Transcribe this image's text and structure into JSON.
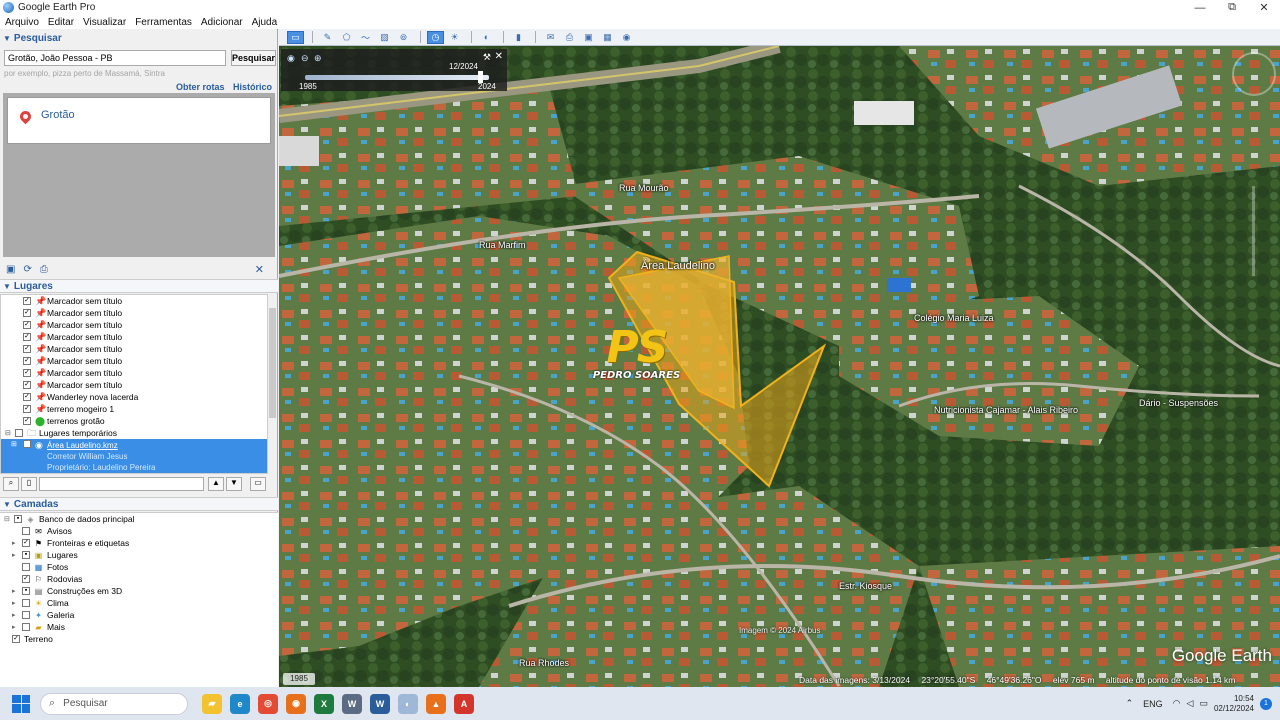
{
  "window": {
    "title": "Google Earth Pro",
    "minimize": "—",
    "maximize": "⧉",
    "close": "✕"
  },
  "menu": [
    "Arquivo",
    "Editar",
    "Visualizar",
    "Ferramentas",
    "Adicionar",
    "Ajuda"
  ],
  "search": {
    "header": "Pesquisar",
    "query": "Grotão, João Pessoa - PB",
    "button": "Pesquisar",
    "hint": "por exemplo, pizza perto de Massamá, Sintra",
    "routes": "Obter rotas",
    "history": "Histórico",
    "result": "Grotão"
  },
  "places": {
    "header": "Lugares",
    "items": [
      "Marcador sem título",
      "Marcador sem título",
      "Marcador sem título",
      "Marcador sem título",
      "Marcador sem título",
      "Marcador sem título",
      "Marcador sem título",
      "Marcador sem título",
      "Wanderley nova lacerda",
      "terreno mogeiro 1",
      "terrenos grotão"
    ],
    "temp_folder": "Lugares temporários",
    "selected": {
      "name": "Área Laudelino.kmz",
      "line1": "Corretor William Jesus",
      "line2": "Proprietário: Laudelino Pereira"
    }
  },
  "layers": {
    "header": "Camadas",
    "items": [
      {
        "label": "Banco de dados principal",
        "icon": "database-icon",
        "checked": true
      },
      {
        "label": "Avisos",
        "icon": "envelope-icon",
        "checked": false
      },
      {
        "label": "Fronteiras e etiquetas",
        "icon": "border-icon",
        "checked": true
      },
      {
        "label": "Lugares",
        "icon": "places-icon",
        "checked": true
      },
      {
        "label": "Fotos",
        "icon": "photo-icon",
        "checked": false
      },
      {
        "label": "Rodovias",
        "icon": "road-icon",
        "checked": true
      },
      {
        "label": "Construções em 3D",
        "icon": "building-icon",
        "checked": true
      },
      {
        "label": "Clima",
        "icon": "weather-icon",
        "checked": false
      },
      {
        "label": "Galeria",
        "icon": "gallery-icon",
        "checked": false
      },
      {
        "label": "Mais",
        "icon": "folder-icon",
        "checked": false
      },
      {
        "label": "Terreno",
        "icon": "",
        "checked": true
      }
    ]
  },
  "historical": {
    "date": "12/2024",
    "start_year": "1985",
    "end_year": "2024",
    "progress": 0.95
  },
  "map": {
    "area_label": "Área Laudelino",
    "labels": {
      "road": "Estr. Kiosque",
      "l1": "Colégio Maria Luiza",
      "l2": "Nutricionista Cajamar - Alais Ribeiro",
      "l3": "Dário - Suspensões",
      "l4": "Rua Mourão",
      "l5": "Rua Marfim",
      "l6": "Rua Rhodes"
    },
    "watermark_logo": "PS",
    "watermark_name": "PEDRO SOARES",
    "brand": "Google Earth",
    "year_badge": "1985",
    "copyright": "Imagem © 2024 Airbus",
    "status": {
      "imagery_date": "Data das imagens: 3/13/2024",
      "lat": "23°20'55.40\"S",
      "lon": "46°49'36.26\"O",
      "elev": "elev   765 m",
      "eye_alt": "altitude do ponto de visão   1.14 km"
    }
  },
  "taskbar": {
    "search": "Pesquisar",
    "lang": "ENG",
    "time": "10:54",
    "date": "02/12/2024",
    "notifications": "1"
  },
  "colors": {
    "area_fill": "#e7a51c",
    "area_stroke": "#f2b21a",
    "accent": "#2a5d9c",
    "selection": "#3a8ee6"
  }
}
